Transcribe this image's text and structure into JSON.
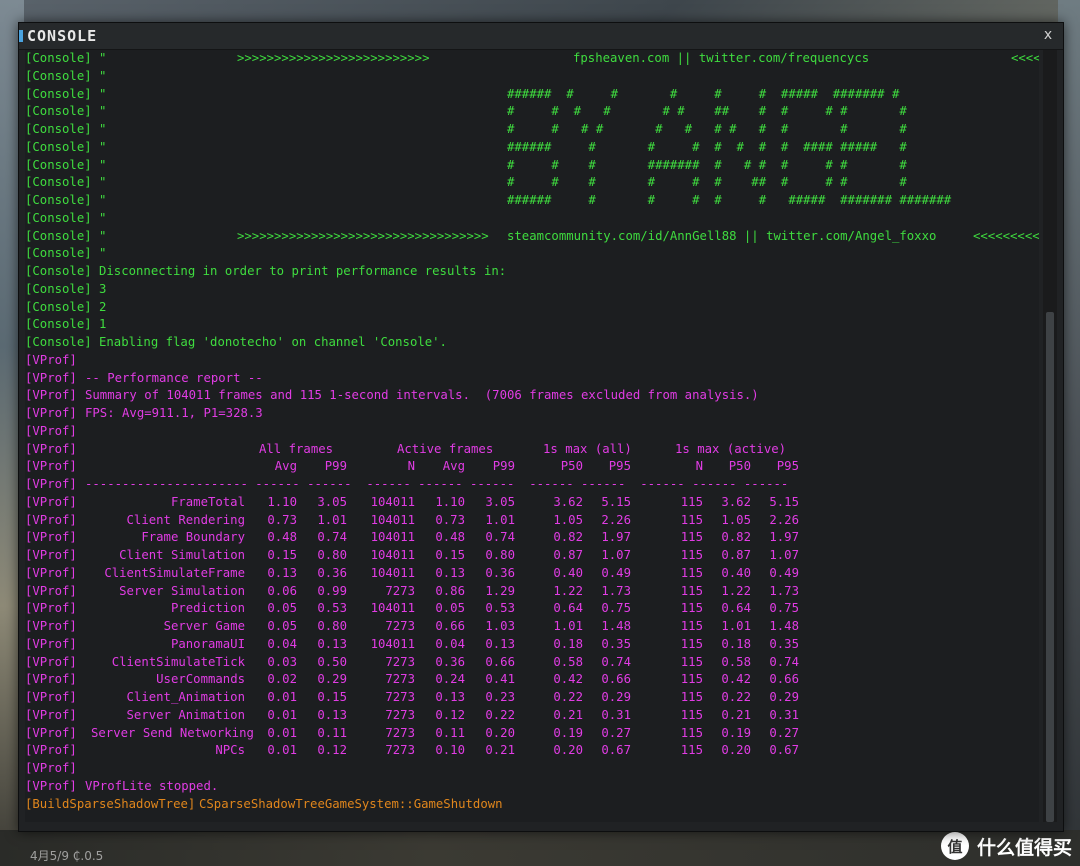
{
  "window": {
    "title": "CONSOLE",
    "close_label": "x"
  },
  "console_header": [
    {
      "tag": "[Console]",
      "text": "\"",
      "mid": ">>>>>>>>>>>>>>>>>>>>>>>>>>",
      "right": "fpsheaven.com || twitter.com/frequencycs",
      "end": "<<<<<<<<"
    },
    {
      "tag": "[Console]",
      "text": "\""
    }
  ],
  "ascii_art": [
    "######  #     #       #     #     #  #####  ####### #",
    "#     #  #   #       # #    ##    #  #     # #       #",
    "#     #   # #       #   #   # #   #  #       #       #",
    "######     #       #     #  #  #  #  #  #### #####   #",
    "#     #    #       #######  #   # #  #     # #       #",
    "#     #    #       #     #  #    ##  #     # #       #",
    "######     #       #     #  #     #   #####  ####### #######"
  ],
  "console_mid": {
    "blank_tag": "[Console]",
    "quote": "\"",
    "credits_mid": ">>>>>>>>>>>>>>>>>>>>>>>>>>>>>>>>>>",
    "credits_right": "steamcommunity.com/id/AnnGell88 || twitter.com/Angel_foxxo",
    "credits_end": "<<<<<<<<<<<"
  },
  "console_messages": [
    "Disconnecting in order to print performance results in:",
    "3",
    "2",
    "1",
    "Enabling flag 'donotecho' on channel 'Console'."
  ],
  "vprof_tag": "[VProf]",
  "vprof_intro": [
    "",
    "-- Performance report --",
    "Summary of 104011 frames and 115 1-second intervals.  (7006 frames excluded from analysis.)",
    "FPS: Avg=911.1, P1=328.3",
    ""
  ],
  "vprof_group_headers": {
    "all": "All frames",
    "active": "Active frames",
    "max_all": "1s max (all)",
    "max_active": "1s max (active)"
  },
  "vprof_columns": [
    "Avg",
    "P99",
    "N",
    "Avg",
    "P99",
    "P50",
    "P95",
    "N",
    "P50",
    "P95"
  ],
  "vprof_separator": "---------------------- ------ ------  ------ ------ ------  ------ ------  ------ ------ ------",
  "vprof_rows": [
    {
      "name": "FrameTotal",
      "v": [
        "1.10",
        "3.05",
        "104011",
        "1.10",
        "3.05",
        "3.62",
        "5.15",
        "115",
        "3.62",
        "5.15"
      ]
    },
    {
      "name": "Client Rendering",
      "v": [
        "0.73",
        "1.01",
        "104011",
        "0.73",
        "1.01",
        "1.05",
        "2.26",
        "115",
        "1.05",
        "2.26"
      ]
    },
    {
      "name": "Frame Boundary",
      "v": [
        "0.48",
        "0.74",
        "104011",
        "0.48",
        "0.74",
        "0.82",
        "1.97",
        "115",
        "0.82",
        "1.97"
      ]
    },
    {
      "name": "Client Simulation",
      "v": [
        "0.15",
        "0.80",
        "104011",
        "0.15",
        "0.80",
        "0.87",
        "1.07",
        "115",
        "0.87",
        "1.07"
      ]
    },
    {
      "name": "ClientSimulateFrame",
      "v": [
        "0.13",
        "0.36",
        "104011",
        "0.13",
        "0.36",
        "0.40",
        "0.49",
        "115",
        "0.40",
        "0.49"
      ]
    },
    {
      "name": "Server Simulation",
      "v": [
        "0.06",
        "0.99",
        "7273",
        "0.86",
        "1.29",
        "1.22",
        "1.73",
        "115",
        "1.22",
        "1.73"
      ]
    },
    {
      "name": "Prediction",
      "v": [
        "0.05",
        "0.53",
        "104011",
        "0.05",
        "0.53",
        "0.64",
        "0.75",
        "115",
        "0.64",
        "0.75"
      ]
    },
    {
      "name": "Server Game",
      "v": [
        "0.05",
        "0.80",
        "7273",
        "0.66",
        "1.03",
        "1.01",
        "1.48",
        "115",
        "1.01",
        "1.48"
      ]
    },
    {
      "name": "PanoramaUI",
      "v": [
        "0.04",
        "0.13",
        "104011",
        "0.04",
        "0.13",
        "0.18",
        "0.35",
        "115",
        "0.18",
        "0.35"
      ]
    },
    {
      "name": "ClientSimulateTick",
      "v": [
        "0.03",
        "0.50",
        "7273",
        "0.36",
        "0.66",
        "0.58",
        "0.74",
        "115",
        "0.58",
        "0.74"
      ]
    },
    {
      "name": "UserCommands",
      "v": [
        "0.02",
        "0.29",
        "7273",
        "0.24",
        "0.41",
        "0.42",
        "0.66",
        "115",
        "0.42",
        "0.66"
      ]
    },
    {
      "name": "Client_Animation",
      "v": [
        "0.01",
        "0.15",
        "7273",
        "0.13",
        "0.23",
        "0.22",
        "0.29",
        "115",
        "0.22",
        "0.29"
      ]
    },
    {
      "name": "Server Animation",
      "v": [
        "0.01",
        "0.13",
        "7273",
        "0.12",
        "0.22",
        "0.21",
        "0.31",
        "115",
        "0.21",
        "0.31"
      ]
    },
    {
      "name": "Server Send Networking",
      "v": [
        "0.01",
        "0.11",
        "7273",
        "0.11",
        "0.20",
        "0.19",
        "0.27",
        "115",
        "0.19",
        "0.27"
      ]
    },
    {
      "name": "NPCs",
      "v": [
        "0.01",
        "0.12",
        "7273",
        "0.10",
        "0.21",
        "0.20",
        "0.67",
        "115",
        "0.20",
        "0.67"
      ]
    }
  ],
  "vprof_outro": [
    "",
    "VProfLite stopped."
  ],
  "shutdown_line": {
    "tag": "[BuildSparseShadowTree]",
    "text": "CSparseShadowTreeGameSystem::GameShutdown"
  },
  "hud_text": "4月5/9 ₵.0.5",
  "watermark": {
    "logo": "值",
    "text": "什么值得买"
  },
  "colors": {
    "console": "#3fdc3f",
    "vprof": "#e13ce4",
    "shadowtree": "#e0861c",
    "background": "#1c1e20"
  }
}
